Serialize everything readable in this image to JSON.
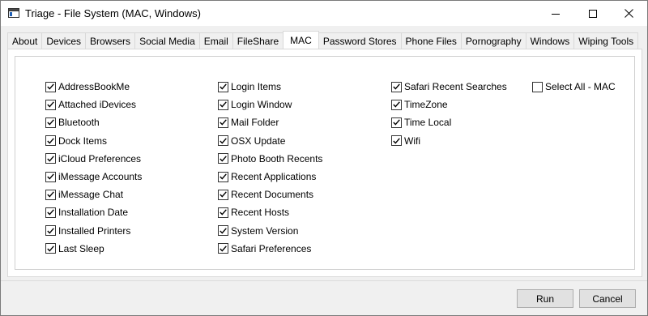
{
  "window": {
    "title": "Triage - File System (MAC, Windows)",
    "icons": {
      "app": "app-window-icon",
      "minimize": "minimize-icon",
      "maximize": "maximize-icon",
      "close": "close-icon"
    }
  },
  "tabs": [
    {
      "label": "About",
      "active": false
    },
    {
      "label": "Devices",
      "active": false
    },
    {
      "label": "Browsers",
      "active": false
    },
    {
      "label": "Social Media",
      "active": false
    },
    {
      "label": "Email",
      "active": false
    },
    {
      "label": "FileShare",
      "active": false
    },
    {
      "label": "MAC",
      "active": true
    },
    {
      "label": "Password Stores",
      "active": false
    },
    {
      "label": "Phone Files",
      "active": false
    },
    {
      "label": "Pornography",
      "active": false
    },
    {
      "label": "Windows",
      "active": false
    },
    {
      "label": "Wiping Tools",
      "active": false
    }
  ],
  "mac": {
    "columns": [
      [
        {
          "label": "AddressBookMe",
          "checked": true
        },
        {
          "label": "Attached iDevices",
          "checked": true
        },
        {
          "label": "Bluetooth",
          "checked": true
        },
        {
          "label": "Dock Items",
          "checked": true
        },
        {
          "label": "iCloud Preferences",
          "checked": true
        },
        {
          "label": "iMessage Accounts",
          "checked": true
        },
        {
          "label": "iMessage Chat",
          "checked": true
        },
        {
          "label": "Installation Date",
          "checked": true
        },
        {
          "label": "Installed Printers",
          "checked": true
        },
        {
          "label": "Last Sleep",
          "checked": true
        }
      ],
      [
        {
          "label": "Login Items",
          "checked": true
        },
        {
          "label": "Login Window",
          "checked": true
        },
        {
          "label": "Mail Folder",
          "checked": true
        },
        {
          "label": "OSX Update",
          "checked": true
        },
        {
          "label": "Photo Booth Recents",
          "checked": true
        },
        {
          "label": "Recent Applications",
          "checked": true
        },
        {
          "label": "Recent Documents",
          "checked": true
        },
        {
          "label": "Recent Hosts",
          "checked": true
        },
        {
          "label": "System Version",
          "checked": true
        },
        {
          "label": "Safari Preferences",
          "checked": true
        }
      ],
      [
        {
          "label": "Safari Recent Searches",
          "checked": true
        },
        {
          "label": "TimeZone",
          "checked": true
        },
        {
          "label": "Time Local",
          "checked": true
        },
        {
          "label": "Wifi",
          "checked": true
        }
      ],
      [
        {
          "label": "Select All - MAC",
          "checked": false
        }
      ]
    ]
  },
  "footer": {
    "run_label": "Run",
    "cancel_label": "Cancel"
  }
}
